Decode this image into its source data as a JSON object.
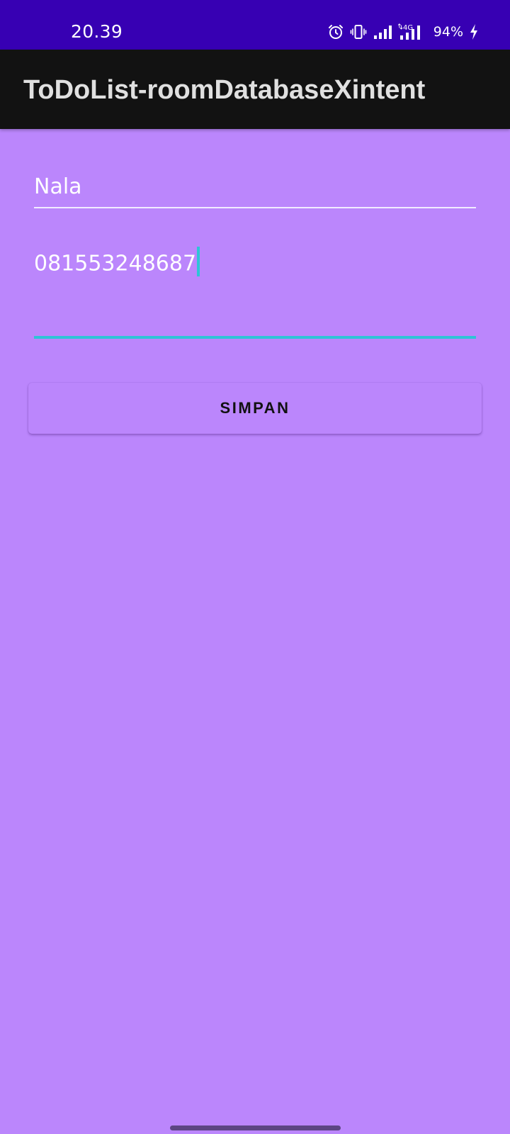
{
  "status_bar": {
    "time": "20.39",
    "battery": "94%",
    "network_label": "4G",
    "icons": [
      "alarm-icon",
      "vibrate-icon",
      "signal-icon",
      "signal-4g-icon",
      "charging-icon"
    ]
  },
  "app_bar": {
    "title": "ToDoList-roomDatabaseXintent"
  },
  "form": {
    "name_value": "Nala",
    "phone_value": "081553248687",
    "save_label": "SIMPAN"
  },
  "colors": {
    "status_bar": "#3700b3",
    "app_bar": "#121212",
    "background": "#bb86fc",
    "accent": "#2ec4d6"
  }
}
